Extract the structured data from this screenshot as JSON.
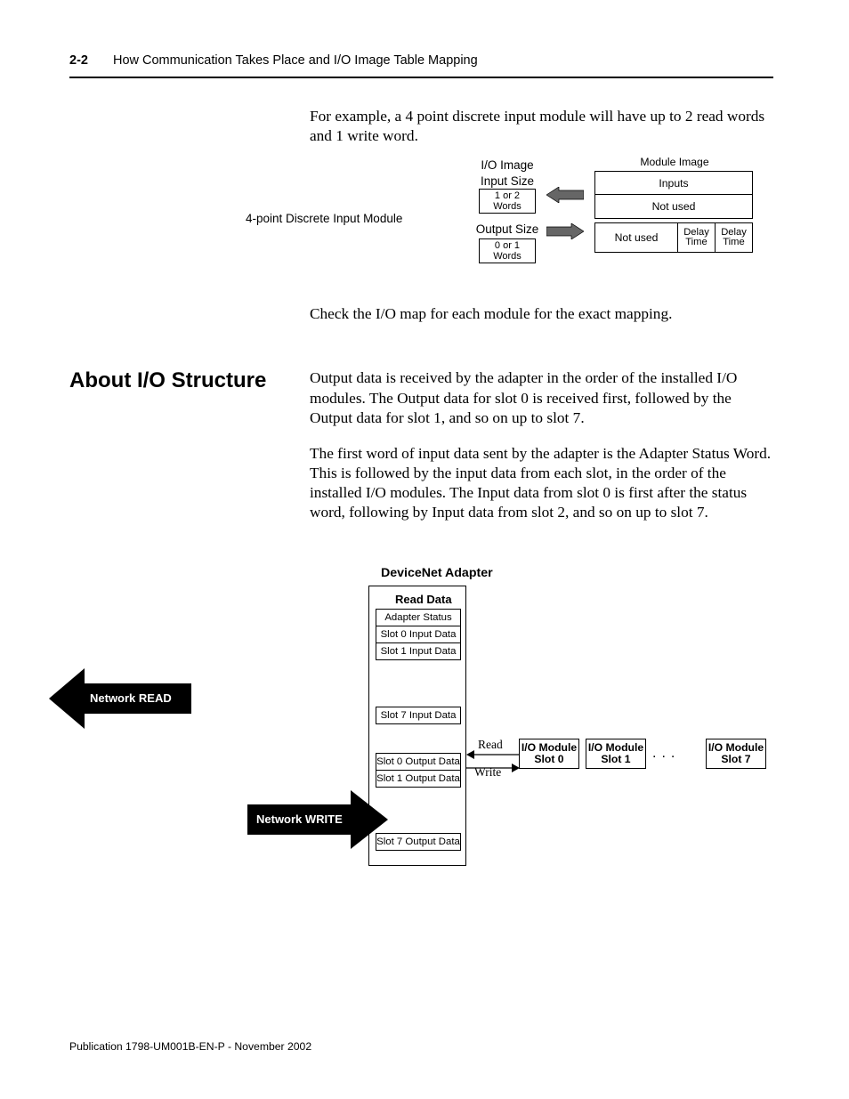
{
  "header": {
    "page_number": "2-2",
    "running_title": "How Communication Takes Place and I/O Image Table Mapping"
  },
  "intro": {
    "para1": "For example, a 4 point discrete input module will have up to 2 read words and 1 write word.",
    "check": "Check the I/O map for each module for the exact mapping."
  },
  "diagram1": {
    "module_label": "4-point Discrete Input Module",
    "io_image": "I/O Image",
    "input_size": "Input Size",
    "words_in": "1 or 2 Words",
    "output_size": "Output Size",
    "words_out": "0 or 1 Words",
    "module_image": "Module Image",
    "inputs": "Inputs",
    "not_used": "Not used",
    "not_used2": "Not used",
    "delay1": "Delay Time",
    "delay2": "Delay Time"
  },
  "section": {
    "heading": "About I/O Structure",
    "para1": "Output data is received by the adapter in the order of the installed I/O modules. The Output data for slot 0 is received first, followed by the Output data for slot 1, and so on up to slot 7.",
    "para2": "The first word of input data sent by the adapter is the Adapter Status Word. This is followed by the input data from each slot, in the order of the installed I/O modules. The Input data from slot 0 is first after the status word, following by Input data from slot 2, and so on up to slot 7."
  },
  "diagram2": {
    "title": "DeviceNet Adapter",
    "read_title": "Read Data",
    "read_rows": [
      "Adapter Status",
      "Slot 0 Input Data",
      "Slot 1 Input Data"
    ],
    "read_slot7": "Slot 7 Input Data",
    "write_rows": [
      "Slot 0 Output Data",
      "Slot 1 Output Data"
    ],
    "write_slot7": "Slot 7 Output Data",
    "net_read": "Network READ",
    "net_write": "Network WRITE",
    "mod0": "I/O Module Slot 0",
    "mod1": "I/O Module Slot 1",
    "mod7": "I/O Module Slot 7",
    "read_label": "Read",
    "write_label": "Write"
  },
  "footer": {
    "text": "Publication 1798-UM001B-EN-P - November 2002"
  }
}
